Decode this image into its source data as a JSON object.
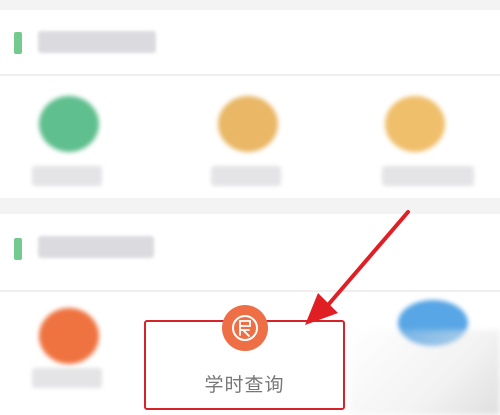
{
  "featured_item": {
    "label": "学时查询",
    "icon": "hours-query-icon",
    "icon_color": "#ee6e45"
  },
  "annotation": {
    "box_color": "#d6232a",
    "arrow_color": "#e01f25"
  },
  "colors": {
    "section_marker": "#74c98f",
    "item_1_icon": "#5fbf8e",
    "item_2_icon": "#e9b766",
    "item_3_icon": "#f0bf6b",
    "item_4_icon": "#ef7340",
    "item_6_icon": "#58a6e6"
  }
}
